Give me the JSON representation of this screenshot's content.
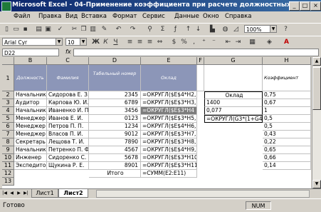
{
  "window": {
    "title": "Microsoft Excel - 04-Применение коэффициента при расчете должностных окладов",
    "minimize": "_",
    "maximize": "□",
    "close": "×"
  },
  "menu": [
    "Файл",
    "Правка",
    "Вид",
    "Вставка",
    "Формат",
    "Сервис",
    "Данные",
    "Окно",
    "Справка"
  ],
  "toolbar": {
    "zoom": "100%",
    "font_name": "Arial Cyr",
    "font_size": "10"
  },
  "formula_bar": {
    "name_box": "D22",
    "fx": "fx",
    "content": ""
  },
  "columns": [
    "B",
    "C",
    "D",
    "E",
    "F",
    "G",
    "H"
  ],
  "rows": [
    "1",
    "2",
    "3",
    "4",
    "5",
    "6",
    "7",
    "8",
    "9",
    "10",
    "11",
    "12",
    "13"
  ],
  "headers": {
    "position": "Должность",
    "name": "Фамилия",
    "tab_no": "Табельный номер",
    "salary": "Оклад",
    "coef": "Коэффициент"
  },
  "table_rows": [
    {
      "pos": "Начальник",
      "name": "Сидорова Е. З.",
      "num": "2345",
      "formula": "=ОКРУГЛ($E$4*H2,"
    },
    {
      "pos": "Аудитор",
      "name": "Карпова Ю. И.",
      "num": "6789",
      "formula": "=ОКРУГЛ($E$3*H3,"
    },
    {
      "pos": "Начальник",
      "name": "Иваненко И. П.",
      "num": "3456",
      "formula": "=ОКРУГЛ($E$3*H4"
    },
    {
      "pos": "Менеджер",
      "name": "Иванов Е. И.",
      "num": "0123",
      "formula": "=ОКРУГЛ($E$3*H5,"
    },
    {
      "pos": "Менеджер",
      "name": "Петров П. П.",
      "num": "1234",
      "formula": "=ОКРУГЛ($E$4*H6,"
    },
    {
      "pos": "Менеджер",
      "name": "Власов П. И.",
      "num": "9012",
      "formula": "=ОКРУГЛ($E$3*H7,"
    },
    {
      "pos": "Секретарь",
      "name": "Лещова Т. И.",
      "num": "7890",
      "formula": "=ОКРУГЛ($E$3*H8,"
    },
    {
      "pos": "Начальник",
      "name": "Петренко П. Ф.",
      "num": "4567",
      "formula": "=ОКРУГЛ($E$4*H9,"
    },
    {
      "pos": "Инженер",
      "name": "Сидоренко С. Е.",
      "num": "5678",
      "formula": "=ОКРУГЛ($E$3*H10"
    },
    {
      "pos": "Экспедитор",
      "name": "Щукина Р. Е.",
      "num": "8901",
      "formula": "=ОКРУГЛ($E$3*H11"
    }
  ],
  "coefficients": [
    "0,75",
    "0,67",
    "1",
    "0,5",
    "0,5",
    "0,43",
    "0,22",
    "0,65",
    "0,66",
    "0,14"
  ],
  "salary_box": {
    "label": "Оклад",
    "g3": "1400",
    "g4": "0,077",
    "g5": "=ОКРУГЛ(G3*(1+G4"
  },
  "total": {
    "label": "Итого",
    "formula": "=СУММ(E2:E11)"
  },
  "sheets": [
    "Лист1",
    "Лист2"
  ],
  "status": {
    "text": "Готово",
    "num": "NUM"
  }
}
